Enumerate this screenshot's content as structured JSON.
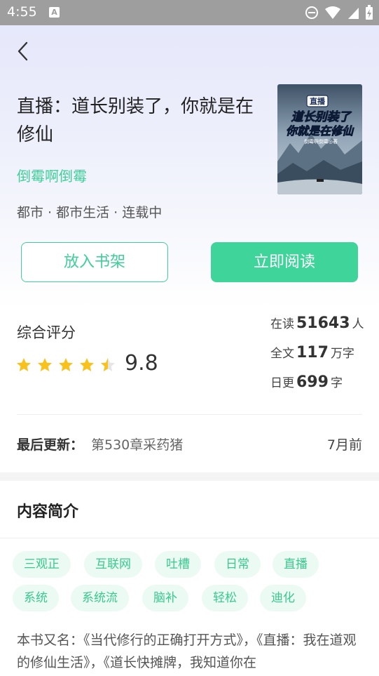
{
  "status_bar": {
    "time": "4:55",
    "notification_icon_letter": "A"
  },
  "book": {
    "title": "直播：道长别装了，你就是在修仙",
    "author": "倒霉啊倒霉",
    "meta": "都市 · 都市生活 · 连载中",
    "cover": {
      "badge": "直播",
      "title_line1": "道长别装了",
      "title_line2": "你就是在修仙",
      "author_line": "倒霉啊倒霉◎著"
    }
  },
  "buttons": {
    "add_to_shelf": "放入书架",
    "read_now": "立即阅读"
  },
  "rating": {
    "label": "综合评分",
    "score": "9.8",
    "stars": 4.5
  },
  "stats": {
    "reading_prefix": "在读",
    "reading_value": "51643",
    "reading_unit": "人",
    "words_prefix": "全文",
    "words_value": "117",
    "words_unit": "万字",
    "daily_prefix": "日更",
    "daily_value": "699",
    "daily_unit": "字"
  },
  "last_update": {
    "label": "最后更新：",
    "chapter": "第530章采药猪",
    "time": "7月前"
  },
  "intro": {
    "title": "内容简介",
    "tags": [
      "三观正",
      "互联网",
      "吐槽",
      "日常",
      "直播",
      "系统",
      "系统流",
      "脑补",
      "轻松",
      "迪化"
    ],
    "synopsis": "本书又名：《当代修行的正确打开方式》，《直播：我在道观的修仙生活》，《道长快摊牌，我知道你在"
  },
  "colors": {
    "accent": "#3fd49a",
    "star": "#f8c11c",
    "hero_bg": "#e6e8fb"
  }
}
